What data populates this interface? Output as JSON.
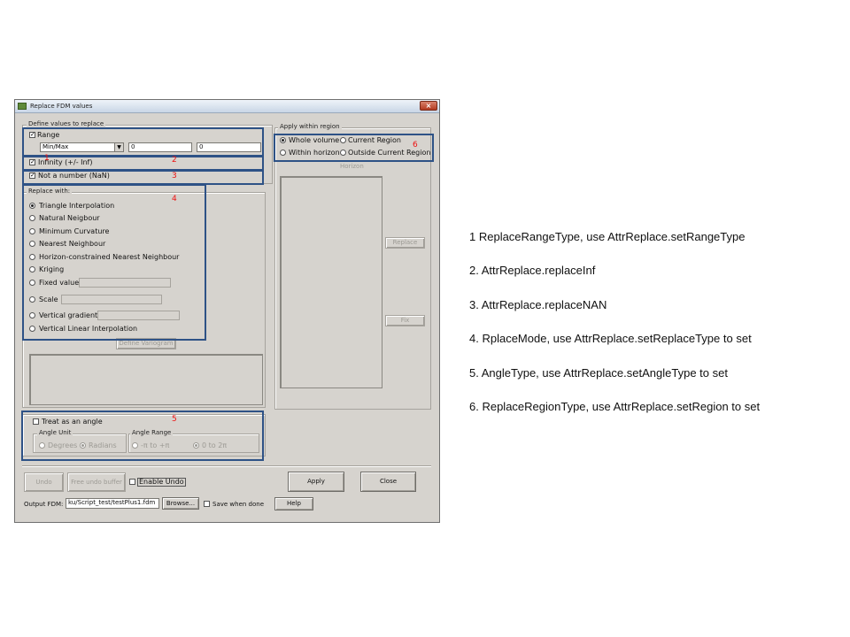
{
  "window": {
    "title": "Replace FDM values"
  },
  "define": {
    "group_label": "Define values to replace",
    "range_label": "Range",
    "range_checked": true,
    "range_type": "Min/Max",
    "range_min": "0",
    "range_max": "0",
    "infinity_label": "Infinity (+/- Inf)",
    "infinity_checked": true,
    "nan_label": "Not a number (NaN)",
    "nan_checked": true
  },
  "replace_with": {
    "group_label": "Replace with:",
    "options": [
      {
        "label": "Triangle Interpolation",
        "selected": true
      },
      {
        "label": "Natural Neigbour",
        "selected": false
      },
      {
        "label": "Minimum Curvature",
        "selected": false
      },
      {
        "label": "Nearest Neighbour",
        "selected": false
      },
      {
        "label": "Horizon-constrained Nearest Neighbour",
        "selected": false
      },
      {
        "label": "Kriging",
        "selected": false
      },
      {
        "label": "Fixed value",
        "selected": false
      },
      {
        "label": "Scale",
        "selected": false
      },
      {
        "label": "Vertical gradient",
        "selected": false
      },
      {
        "label": "Vertical Linear Interpolation",
        "selected": false
      }
    ],
    "define_variogram_label": "Define Variogram"
  },
  "angle": {
    "treat_label": "Treat as an angle",
    "treat_checked": false,
    "unit_group_label": "Angle Unit",
    "degrees_label": "Degrees",
    "radians_label": "Radians",
    "range_group_label": "Angle Range",
    "pi_range_label": "-π to +π",
    "twopi_range_label": "0 to 2π"
  },
  "region": {
    "group_label": "Apply within region",
    "whole_volume": "Whole volume",
    "current_region": "Current Region",
    "within_horizon": "Within horizon",
    "outside_current_region": "Outside Current Region",
    "selected": "Whole volume",
    "horizon_label": "Horizon",
    "replace_label": "Replace",
    "fix_label": "Fix"
  },
  "bottom": {
    "undo_label": "Undo",
    "free_undo_label": "Free undo buffer",
    "enable_undo_label": "Enable Undo",
    "enable_undo_checked": false,
    "apply_label": "Apply",
    "close_label": "Close",
    "output_label": "Output FDM:",
    "output_value": "ku/Script_test/testPlus1.fdm",
    "browse_label": "Browse...",
    "save_done_label": "Save when done",
    "save_done_checked": false,
    "help_label": "Help"
  },
  "markers": [
    "1",
    "2",
    "3",
    "4",
    "5",
    "6"
  ],
  "annotation_color": "#2e5286",
  "notes": [
    "1 ReplaceRangeType, use AttrReplace.setRangeType",
    "2. AttrReplace.replaceInf",
    "3. AttrReplace.replaceNAN",
    "4. RplaceMode, use AttrReplace.setReplaceType to set",
    "5. AngleType, use AttrReplace.setAngleType to set",
    "6. ReplaceRegionType, use AttrReplace.setRegion to set"
  ]
}
